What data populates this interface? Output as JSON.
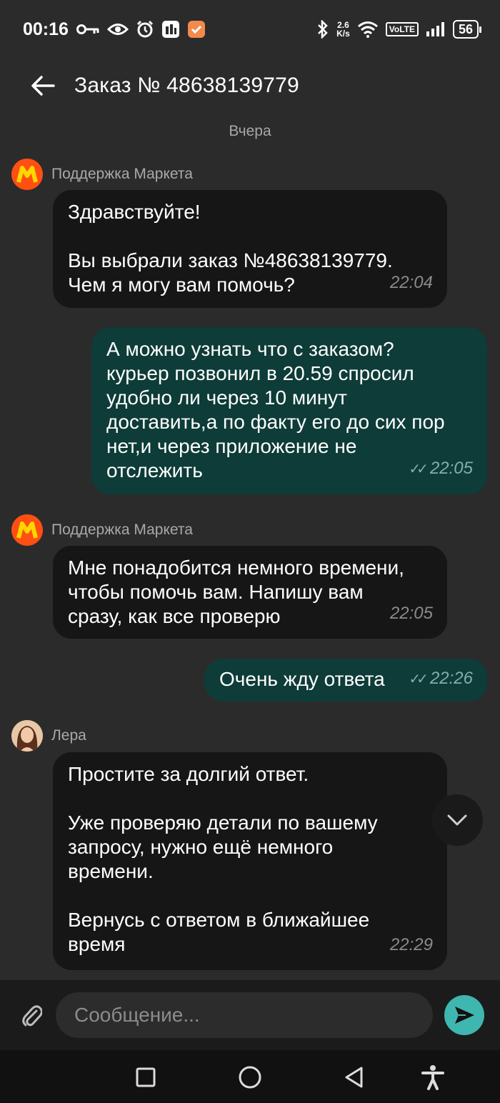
{
  "status_bar": {
    "time": "00:16",
    "net_speed_top": "2.6",
    "net_speed_bottom": "K/s",
    "volte": "VoLTE",
    "battery": "56",
    "icons": [
      "key-icon",
      "eye-icon",
      "alarm-icon",
      "app-notification-icon",
      "app-badge-icon",
      "bluetooth-icon",
      "wifi-icon",
      "signal-icon"
    ]
  },
  "header": {
    "title": "Заказ № 48638139779",
    "back_icon": "arrow-left-icon"
  },
  "chat": {
    "date_separator": "Вчера",
    "messages": [
      {
        "sender": "Поддержка Маркета",
        "text": "Здравствуйте!\n\nВы выбрали заказ №48638139779.\nЧем я могу вам помочь?",
        "time": "22:04",
        "direction": "in"
      },
      {
        "text": "А можно узнать что с заказом?\nкурьер позвонил в 20.59 спросил\nудобно ли через 10 минут\nдоставить,а по факту его до сих пор\nнет,и через приложение не\nотслежить",
        "time": "22:05",
        "direction": "out",
        "status": "read"
      },
      {
        "sender": "Поддержка Маркета",
        "text": "Мне понадобится немного времени,\nчтобы помочь вам. Напишу вам\nсразу, как все проверю",
        "time": "22:05",
        "direction": "in"
      },
      {
        "text": "Очень жду ответа",
        "time": "22:26",
        "direction": "out",
        "status": "read"
      },
      {
        "sender": "Лера",
        "text": "Простите за долгий ответ.\n\nУже проверяю детали по вашему\nзапросу, нужно ещё немного\nвремени.\n\nВернусь с ответом в ближайшее\nвремя",
        "time": "22:29",
        "direction": "in"
      }
    ]
  },
  "composer": {
    "placeholder": "Сообщение...",
    "value": ""
  },
  "colors": {
    "background": "#2b2b2b",
    "incoming_bubble": "#161616",
    "outgoing_bubble": "#0e3c38",
    "send_button": "#3fb6b0",
    "market_brand": "#ff4f12"
  }
}
